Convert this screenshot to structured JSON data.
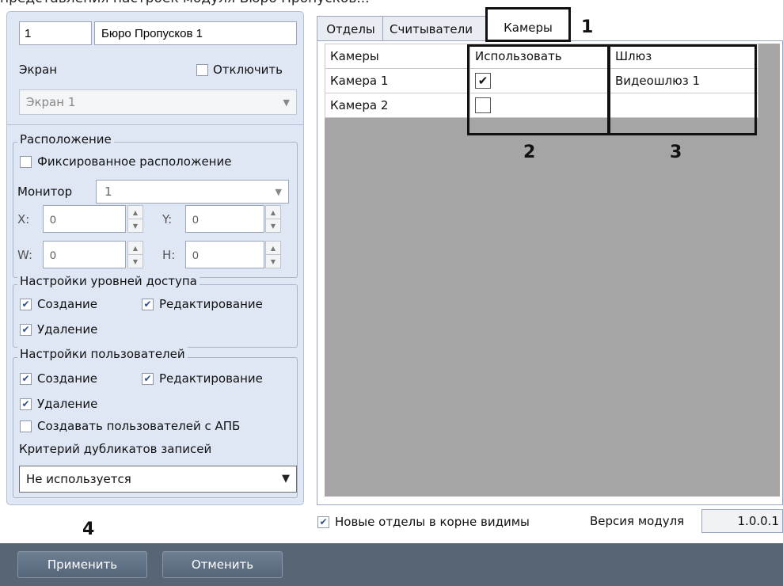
{
  "top_text": "представления настроек модуля Бюро Пропусков...",
  "header": {
    "id_value": "1",
    "name_value": "Бюро Пропусков 1"
  },
  "screen": {
    "label": "Экран",
    "disable_label": "Отключить",
    "disable_checked": false,
    "select_value": "Экран 1"
  },
  "location": {
    "legend": "Расположение",
    "fixed_label": "Фиксированное расположение",
    "fixed_checked": false,
    "monitor_label": "Монитор",
    "monitor_value": "1",
    "x_label": "X:",
    "x_value": "0",
    "y_label": "Y:",
    "y_value": "0",
    "w_label": "W:",
    "w_value": "0",
    "h_label": "H:",
    "h_value": "0"
  },
  "access": {
    "legend": "Настройки уровней доступа",
    "create_label": "Создание",
    "create_checked": true,
    "edit_label": "Редактирование",
    "edit_checked": true,
    "delete_label": "Удаление",
    "delete_checked": true
  },
  "users": {
    "legend": "Настройки пользователей",
    "create_label": "Создание",
    "create_checked": true,
    "edit_label": "Редактирование",
    "edit_checked": true,
    "delete_label": "Удаление",
    "delete_checked": true,
    "apb_label": "Создавать пользователей с АПБ",
    "apb_checked": false,
    "dup_label": "Критерий дубликатов записей",
    "dup_value": "Не используется"
  },
  "tabs": [
    {
      "label": "Отделы",
      "active": false
    },
    {
      "label": "Считыватели",
      "active": false
    },
    {
      "label": "Камеры",
      "active": true
    }
  ],
  "table": {
    "headers": [
      "Камеры",
      "Использовать",
      "Шлюз"
    ],
    "rows": [
      {
        "camera": "Камера 1",
        "use": true,
        "gateway": "Видеошлюз 1"
      },
      {
        "camera": "Камера 2",
        "use": false,
        "gateway": ""
      }
    ]
  },
  "bottom": {
    "new_depts_label": "Новые отделы в корне видимы",
    "new_depts_checked": true,
    "version_label": "Версия модуля",
    "version_value": "1.0.0.1"
  },
  "callouts": [
    "1",
    "2",
    "3",
    "4"
  ],
  "buttons": {
    "apply": "Применить",
    "cancel": "Отменить"
  },
  "colors": {
    "panel_bg": "#dfe7f5",
    "grid_bg": "#a5a5a5",
    "footer_bg": "#586575",
    "check_color": "#2e4f94"
  }
}
